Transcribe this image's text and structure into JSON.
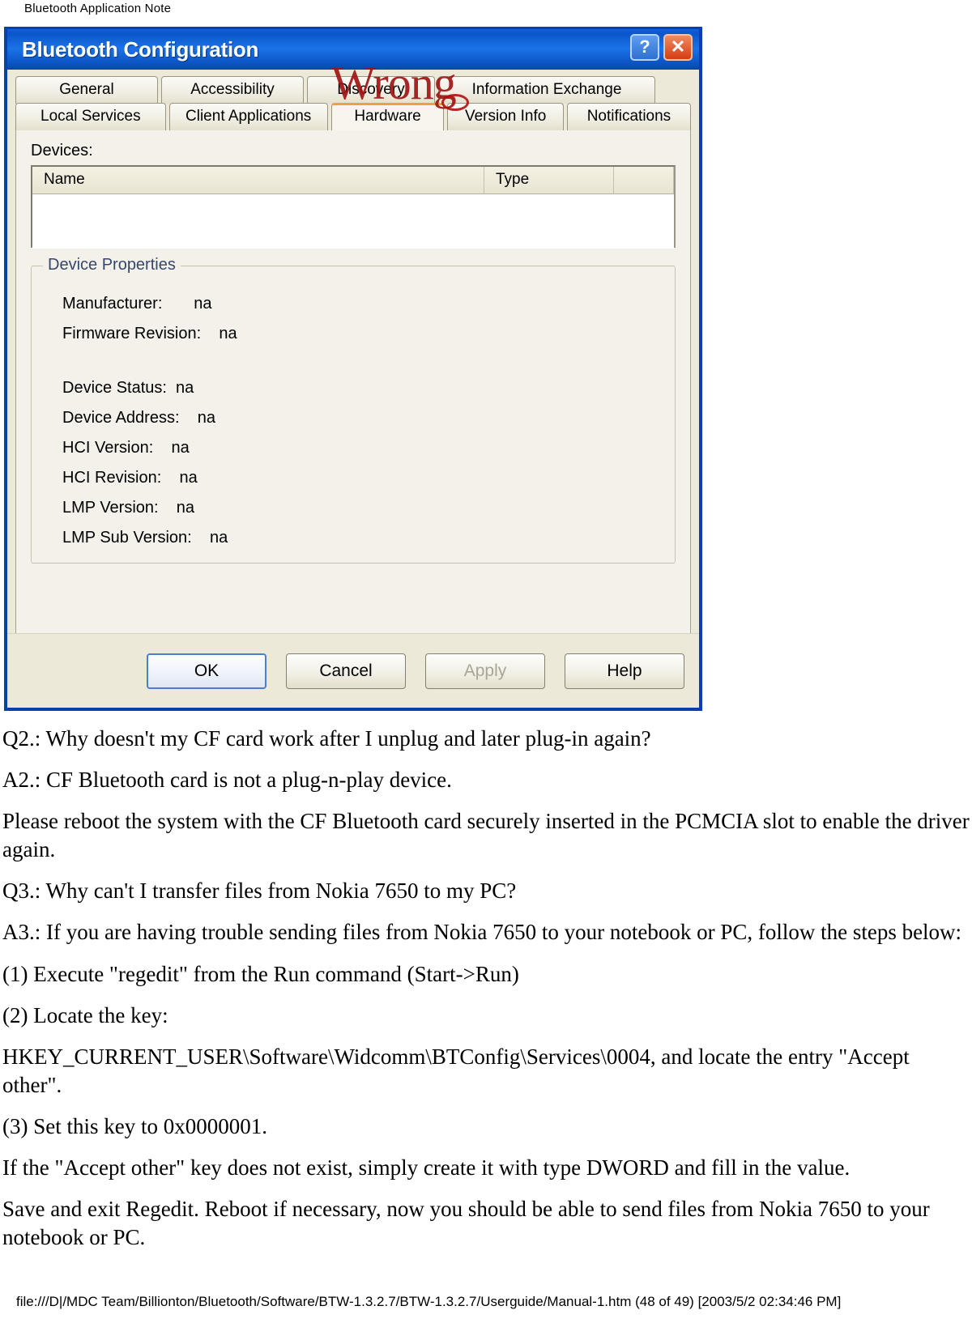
{
  "page": {
    "header": "Bluetooth Application Note",
    "footer": "file:///D|/MDC Team/Billionton/Bluetooth/Software/BTW-1.3.2.7/BTW-1.3.2.7/Userguide/Manual-1.htm (48 of 49) [2003/5/2 02:34:46 PM]"
  },
  "annotation": {
    "text": "Wrong",
    "color": "#a01515"
  },
  "dialog": {
    "title": "Bluetooth Configuration",
    "titlebar_color": "#0a55c8",
    "help_button": "?",
    "close_button": "✕",
    "tabs_row1": [
      {
        "label": "General",
        "active": false
      },
      {
        "label": "Accessibility",
        "active": false
      },
      {
        "label": "Discovery",
        "active": false
      },
      {
        "label": "Information Exchange",
        "active": false
      }
    ],
    "tabs_row2": [
      {
        "label": "Local Services",
        "active": false
      },
      {
        "label": "Client Applications",
        "active": false
      },
      {
        "label": "Hardware",
        "active": true
      },
      {
        "label": "Version Info",
        "active": false
      },
      {
        "label": "Notifications",
        "active": false
      }
    ],
    "devices": {
      "label": "Devices:",
      "columns": [
        "Name",
        "Type"
      ],
      "rows": []
    },
    "device_properties": {
      "title": "Device Properties",
      "items": [
        {
          "label": "Manufacturer:",
          "value": "na"
        },
        {
          "label": "Firmware Revision:",
          "value": "na"
        },
        {
          "label": "Device Status:",
          "value": "na"
        },
        {
          "label": "Device Address:",
          "value": "na"
        },
        {
          "label": "HCI Version:",
          "value": "na"
        },
        {
          "label": "HCI Revision:",
          "value": "na"
        },
        {
          "label": "LMP Version:",
          "value": "na"
        },
        {
          "label": "LMP Sub Version:",
          "value": "na"
        }
      ],
      "lines": [
        "Manufacturer:       na",
        "Firmware Revision:    na",
        "Device Status:  na",
        "Device Address:    na",
        "HCI Version:    na",
        "HCI Revision:    na",
        "LMP Version:    na",
        "LMP Sub Version:    na"
      ]
    },
    "buttons": {
      "ok": "OK",
      "cancel": "Cancel",
      "apply": "Apply",
      "help": "Help"
    }
  },
  "content": {
    "paragraphs": [
      "Q2.: Why doesn't my CF card work after I unplug and later plug-in again?",
      "A2.: CF Bluetooth card is not a plug-n-play device.",
      "Please reboot the system with the CF Bluetooth card securely inserted in the PCMCIA slot to enable the driver again.",
      "Q3.: Why can't I transfer files from Nokia 7650 to my PC?",
      "A3.: If you are having trouble sending files from Nokia 7650 to your notebook or PC, follow the steps below:",
      "(1) Execute \"regedit\" from the Run command (Start->Run)",
      "(2) Locate the key:",
      "HKEY_CURRENT_USER\\Software\\Widcomm\\BTConfig\\Services\\0004, and locate the entry \"Accept other\".",
      "(3) Set this key to 0x0000001.",
      "If the \"Accept other\" key does not exist, simply create it with type DWORD and fill in the value.",
      "Save and exit Regedit. Reboot if necessary, now you should be able to send files from Nokia 7650 to your notebook or PC."
    ]
  }
}
